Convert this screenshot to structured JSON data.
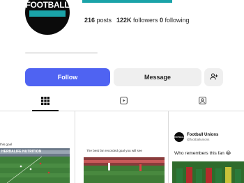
{
  "profile": {
    "logo_text": "FOOTBALL",
    "stats": {
      "posts_count": "216",
      "posts_label": "posts",
      "followers_count": "122K",
      "followers_label": "followers",
      "following_count": "0",
      "following_label": "following"
    },
    "accent_color": "#1aa3a8"
  },
  "actions": {
    "follow_label": "Follow",
    "message_label": "Message",
    "add_user_icon": "add-user-icon",
    "follow_color": "#4f63f2"
  },
  "tabs": [
    {
      "icon": "grid-icon",
      "active": true
    },
    {
      "icon": "reels-icon",
      "active": false
    },
    {
      "icon": "tagged-icon",
      "active": false
    }
  ],
  "posts": [
    {
      "caption": "this goal",
      "overlay_text": "HERBALIFE NUTRITION"
    },
    {
      "caption": "The best fan recorded goal you will see"
    },
    {
      "author": "Football Unions",
      "handle": "@footballunions",
      "text": "Who remembers this fan 😂",
      "avatar_text": "FOOTBALL"
    }
  ]
}
